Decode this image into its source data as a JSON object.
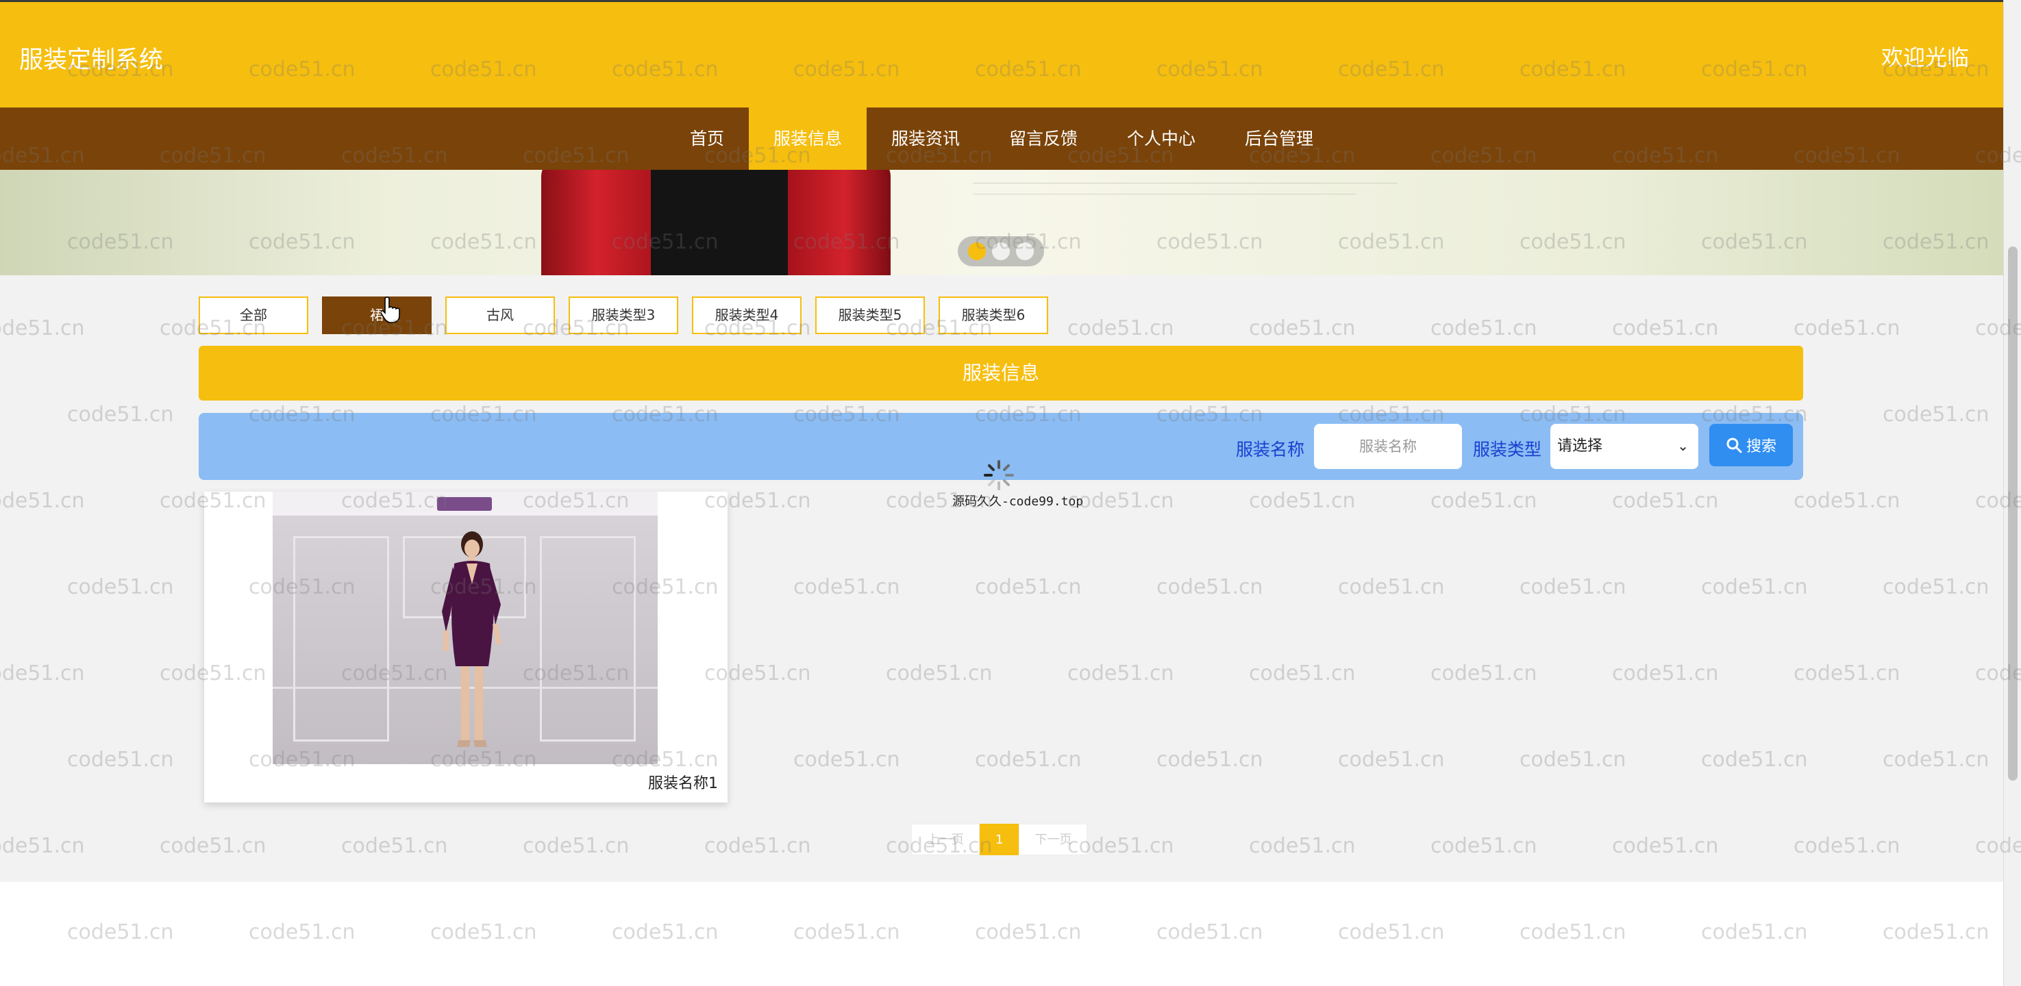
{
  "header": {
    "brand": "服装定制系统",
    "welcome": "欢迎光临"
  },
  "nav": {
    "items": [
      {
        "label": "首页",
        "active": false
      },
      {
        "label": "服装信息",
        "active": true
      },
      {
        "label": "服装资讯",
        "active": false
      },
      {
        "label": "留言反馈",
        "active": false
      },
      {
        "label": "个人中心",
        "active": false
      },
      {
        "label": "后台管理",
        "active": false
      }
    ]
  },
  "banner": {
    "dots": [
      true,
      false,
      false
    ]
  },
  "categories": [
    {
      "label": "全部",
      "active": false
    },
    {
      "label": "裙",
      "active": true
    },
    {
      "label": "古风",
      "active": false
    },
    {
      "label": "服装类型3",
      "active": false
    },
    {
      "label": "服装类型4",
      "active": false
    },
    {
      "label": "服装类型5",
      "active": false
    },
    {
      "label": "服装类型6",
      "active": false
    }
  ],
  "section": {
    "title": "服装信息"
  },
  "search": {
    "name_label": "服装名称",
    "name_placeholder": "服装名称",
    "name_value": "",
    "type_label": "服装类型",
    "type_selected": "请选择",
    "button_label": "搜索"
  },
  "loading": {
    "text": "源码久久-code99.top"
  },
  "products": [
    {
      "name": "服装名称1"
    }
  ],
  "pagination": {
    "prev": "上一页",
    "current": "1",
    "next": "下一页"
  },
  "watermark": {
    "text": "code51.cn"
  },
  "colors": {
    "primary": "#f6be0e",
    "nav": "#7a4309",
    "search_bar": "#8bbcf3",
    "search_button": "#2f8ef0",
    "label_blue": "#1a3fd0"
  }
}
